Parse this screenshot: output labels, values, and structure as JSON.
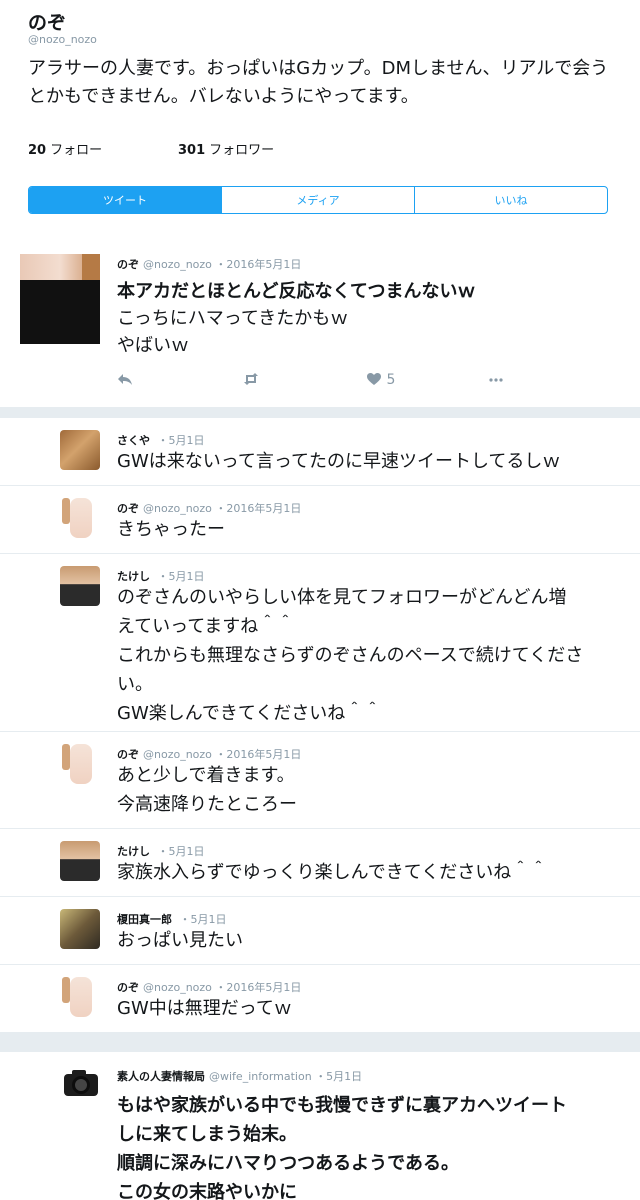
{
  "profile": {
    "name": "のぞ",
    "handle": "@nozo_nozo",
    "bio": "アラサーの人妻です。おっぱいはGカップ。DMしません、リアルで会うとかもできません。バレないようにやってます。",
    "following_count": "20",
    "following_label": "フォロー",
    "followers_count": "301",
    "followers_label": "フォロワー"
  },
  "tabs": [
    "ツイート",
    "メディア",
    "いいね"
  ],
  "main_tweet": {
    "name": "のぞ",
    "handle": "@nozo_nozo",
    "date": "・2016年5月1日",
    "line1": "本アカだとほとんど反応なくてつまんないｗ",
    "line2": "こっちにハマってきたかもｗ",
    "line3": "やばいｗ",
    "like_count": "5"
  },
  "replies": [
    {
      "name": "さくや",
      "handle": "",
      "date": "・5月1日",
      "lines": [
        "GWは来ないって言ってたのに早速ツイートしてるしｗ"
      ]
    },
    {
      "name": "のぞ",
      "handle": "@nozo_nozo",
      "date": "・2016年5月1日",
      "lines": [
        "きちゃったー"
      ]
    },
    {
      "name": "たけし",
      "handle": "",
      "date": "・5月1日",
      "lines": [
        "のぞさんのいやらしい体を見てフォロワーがどんどん増",
        "えていってますね＾＾",
        "これからも無理なさらずのぞさんのペースで続けてくださ",
        "い。",
        "GW楽しんできてくださいね＾＾"
      ]
    },
    {
      "name": "のぞ",
      "handle": "@nozo_nozo",
      "date": "・2016年5月1日",
      "lines": [
        "あと少しで着きます。",
        "今高速降りたところー"
      ]
    },
    {
      "name": "たけし",
      "handle": "",
      "date": "・5月1日",
      "lines": [
        "家族水入らずでゆっくり楽しんできてくださいね＾＾"
      ]
    },
    {
      "name": "榎田真一郎",
      "handle": "",
      "date": "・5月1日",
      "lines": [
        "おっぱい見たい"
      ]
    },
    {
      "name": "のぞ",
      "handle": "@nozo_nozo",
      "date": "・2016年5月1日",
      "lines": [
        "GW中は無理だってｗ"
      ]
    }
  ],
  "quote_tweet": {
    "name": "素人の人妻情報局",
    "handle": "@wife_information",
    "date": "・5月1日",
    "lines": [
      "もはや家族がいる中でも我慢できずに裏アカへツイート",
      "しに来てしまう始末。",
      "順調に深みにハマりつつあるようである。",
      "この女の末路やいかに"
    ]
  },
  "colors": {
    "accent": "#1da1f2",
    "muted": "#8899a6",
    "separator": "#e6ecf0"
  },
  "icons": [
    "reply-icon",
    "retweet-icon",
    "heart-icon",
    "more-icon",
    "camera-icon"
  ]
}
